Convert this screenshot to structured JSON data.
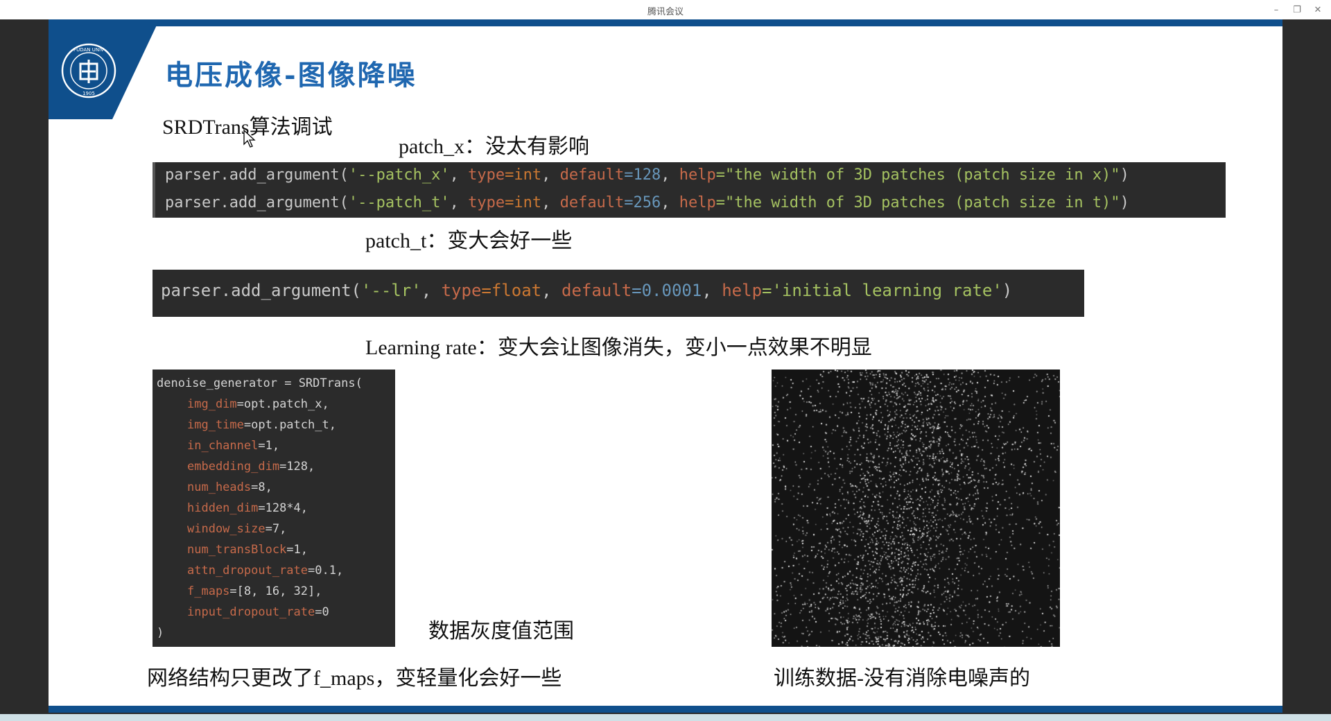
{
  "window": {
    "title": "腾讯会议",
    "controls": [
      "minimize",
      "restore",
      "close"
    ]
  },
  "slide": {
    "title": "电压成像-图像降噪",
    "logo": "fudan-university-logo",
    "subtitle": "SRDTrans算法调试",
    "patch_x_note": "patch_x：没太有影响",
    "patch_t_note": "patch_t：变大会好一些",
    "lr_note": "Learning rate：变大会让图像消失，变小一点效果不明显",
    "gray_range_label": "数据灰度值范围",
    "network_note": "网络结构只更改了f_maps，变轻量化会好一些",
    "train_note": "训练数据-没有消除电噪声的",
    "code_args": [
      {
        "prefix": "parser.add_argument(",
        "name": "'--patch_x'",
        "t1": ", ",
        "type_kw": "type",
        "type_val": "=int",
        "t2": ", ",
        "def_kw": "default",
        "def_val": "=128",
        "t3": ", ",
        "help_kw": "help",
        "help_val": "=\"the width of 3D patches (patch size in x)\"",
        "suffix": ")"
      },
      {
        "prefix": "parser.add_argument(",
        "name": "'--patch_t'",
        "t1": ", ",
        "type_kw": "type",
        "type_val": "=int",
        "t2": ", ",
        "def_kw": "default",
        "def_val": "=256",
        "t3": ", ",
        "help_kw": "help",
        "help_val": "=\"the width of 3D patches (patch size in t)\"",
        "suffix": ")"
      }
    ],
    "code_lr": {
      "prefix": "parser.add_argument(",
      "name": "'--lr'",
      "t1": ", ",
      "type_kw": "type",
      "type_val": "=float",
      "t2": ", ",
      "def_kw": "default",
      "def_val": "=0.0001",
      "t3": ", ",
      "help_kw": "help",
      "help_val": "='initial learning rate'",
      "suffix": ")"
    },
    "code_generator": {
      "head": "denoise_generator = SRDTrans(",
      "params": [
        {
          "key": "img_dim",
          "val": "=opt.patch_x,"
        },
        {
          "key": "img_time",
          "val": "=opt.patch_t,"
        },
        {
          "key": "in_channel",
          "val": "=1,"
        },
        {
          "key": "embedding_dim",
          "val": "=128,"
        },
        {
          "key": "num_heads",
          "val": "=8,"
        },
        {
          "key": "hidden_dim",
          "val": "=128*4,"
        },
        {
          "key": "window_size",
          "val": "=7,"
        },
        {
          "key": "num_transBlock",
          "val": "=1,"
        },
        {
          "key": "attn_dropout_rate",
          "val": "=0.1,"
        },
        {
          "key": "f_maps",
          "val": "=[8, 16, 32],"
        },
        {
          "key": "input_dropout_rate",
          "val": "=0"
        }
      ],
      "tail": ")"
    },
    "colors": {
      "brand_blue": "#0f4f8c",
      "title_blue": "#1f67b0",
      "code_bg": "#2b2b2b"
    }
  }
}
